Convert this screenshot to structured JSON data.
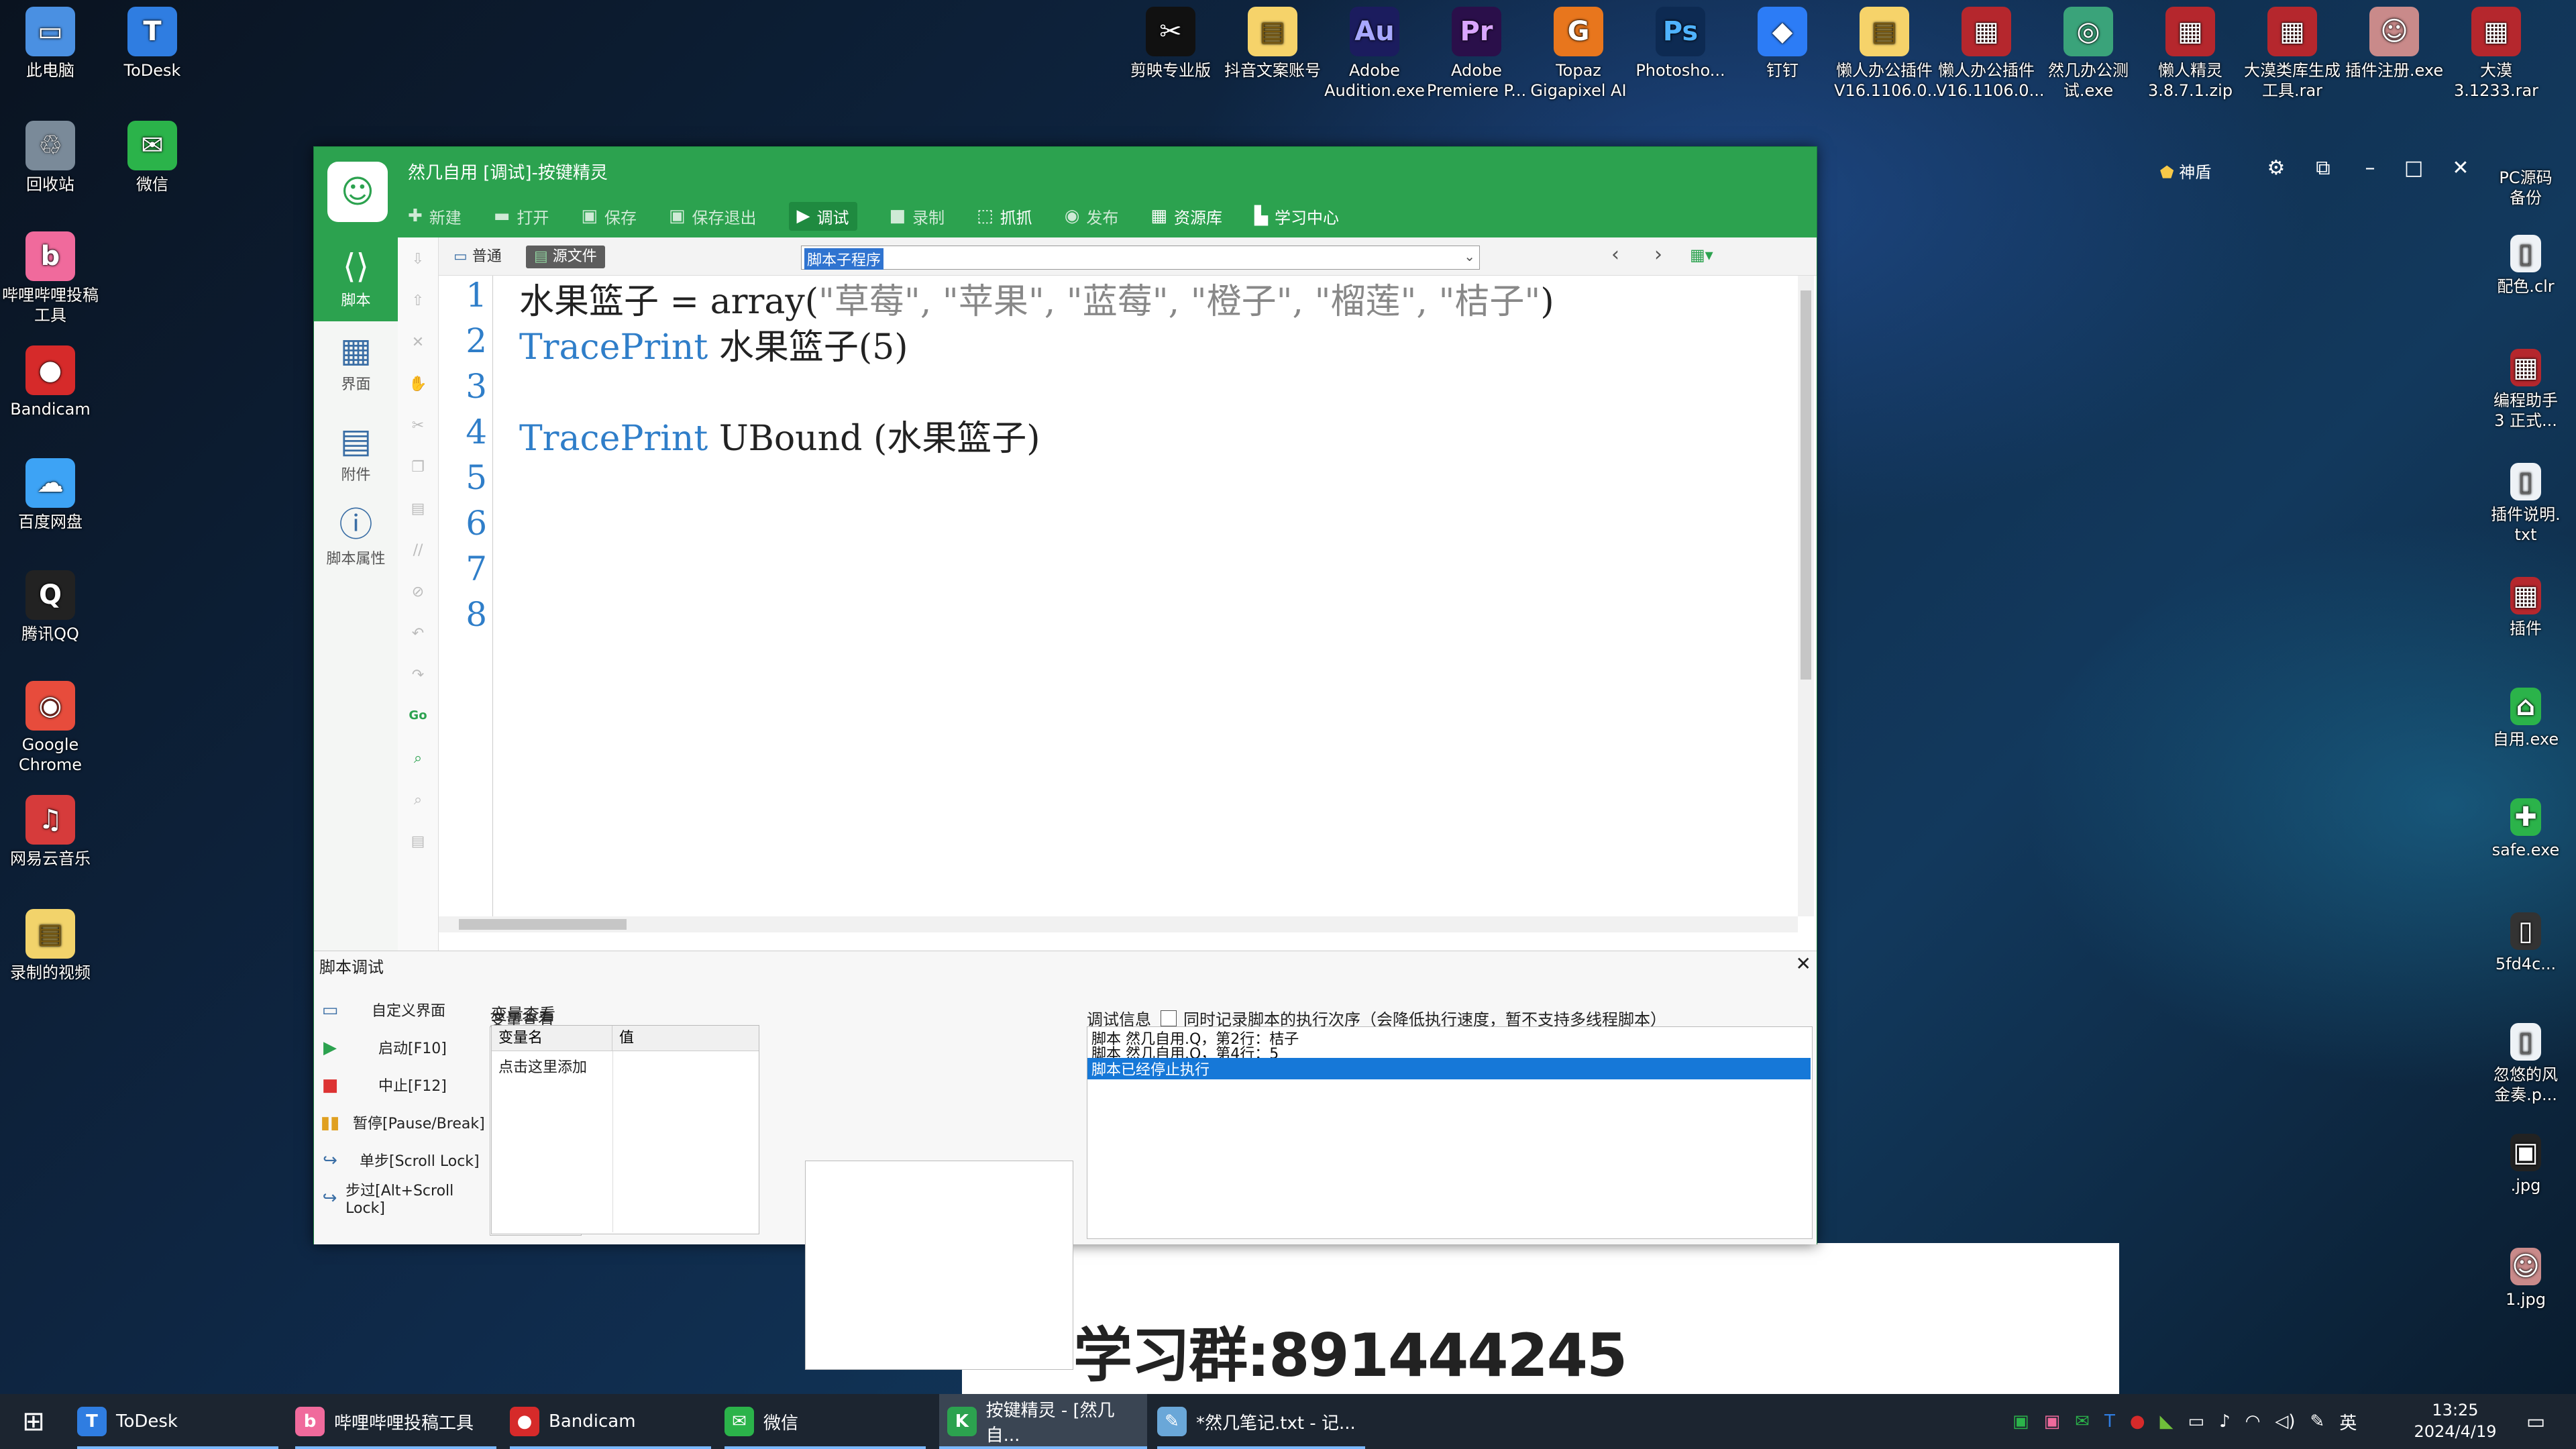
{
  "desktop": {
    "left_icons": [
      {
        "label": "此电脑",
        "color": "#4a90e2",
        "glyph": "▭"
      },
      {
        "label": "ToDesk",
        "color": "#2f7de1",
        "glyph": "T"
      },
      {
        "label": "回收站",
        "color": "#7a8a99",
        "glyph": "♲"
      },
      {
        "label": "微信",
        "color": "#2bb34a",
        "glyph": "✉"
      },
      {
        "label": "哔哩哔哩投稿\n工具",
        "color": "#f06a9c",
        "glyph": "b"
      },
      {
        "label": "Bandicam",
        "color": "#d62a2a",
        "glyph": "●"
      },
      {
        "label": "百度网盘",
        "color": "#3da3f5",
        "glyph": "☁"
      },
      {
        "label": "腾讯QQ",
        "color": "#222222",
        "glyph": "Q"
      },
      {
        "label": "Google\nChrome",
        "color": "#e74c3c",
        "glyph": "◉"
      },
      {
        "label": "网易云音乐",
        "color": "#d63b3b",
        "glyph": "♫"
      },
      {
        "label": "录制的视频",
        "color": "#f2d36b",
        "glyph": "▤"
      }
    ],
    "top_icons": [
      {
        "label": "剪映专业版",
        "color": "#111111",
        "glyph": "✂"
      },
      {
        "label": "抖音文案账号",
        "color": "#f6d36a",
        "glyph": "▤"
      },
      {
        "label": "Adobe\nAudition.exe",
        "color": "#1b1c5e",
        "glyph": "Au"
      },
      {
        "label": "Adobe\nPremiere P...",
        "color": "#2a0f4a",
        "glyph": "Pr"
      },
      {
        "label": "Topaz\nGigapixel AI",
        "color": "#e8761d",
        "glyph": "G"
      },
      {
        "label": "Photosho...",
        "color": "#0d2a52",
        "glyph": "Ps"
      },
      {
        "label": "钉钉",
        "color": "#2c7cf6",
        "glyph": "◆"
      },
      {
        "label": "懒人办公插件\nV16.1106.0...",
        "color": "#f6d36a",
        "glyph": "▤"
      },
      {
        "label": "懒人办公插件\nV16.1106.0...",
        "color": "#b5272d",
        "glyph": "▦"
      },
      {
        "label": "然几办公测\n试.exe",
        "color": "#3aa37a",
        "glyph": "◎"
      },
      {
        "label": "懒人精灵\n3.8.7.1.zip",
        "color": "#b5272d",
        "glyph": "▦"
      },
      {
        "label": "大漠类库生成\n工具.rar",
        "color": "#b5272d",
        "glyph": "▦"
      },
      {
        "label": "插件注册.exe",
        "color": "#c98a8a",
        "glyph": "☺"
      },
      {
        "label": "大漠\n3.1233.rar",
        "color": "#b5272d",
        "glyph": "▦"
      }
    ],
    "right_icons": [
      {
        "label": "PC源码\n备份"
      },
      {
        "label": "配色.clr"
      },
      {
        "label": "编程助手\n3 正式..."
      },
      {
        "label": "插件说明.\ntxt"
      },
      {
        "label": "插件"
      },
      {
        "label": "自用.exe"
      },
      {
        "label": "safe.exe"
      },
      {
        "label": "5fd4c..."
      },
      {
        "label": "忽悠的风\n金奏.p..."
      },
      {
        "label": ".jpg"
      },
      {
        "label": "1.jpg"
      }
    ]
  },
  "window": {
    "title": "然几自用 [调试]-按键精灵",
    "vip_label": "神盾",
    "toolbar": [
      {
        "label": "新建",
        "icon": "✚"
      },
      {
        "label": "打开",
        "icon": "▬"
      },
      {
        "label": "保存",
        "icon": "▣"
      },
      {
        "label": "保存退出",
        "icon": "▣"
      },
      {
        "label": "调试",
        "icon": "▶"
      },
      {
        "label": "录制",
        "icon": "■"
      },
      {
        "label": "抓抓",
        "icon": "⬚"
      },
      {
        "label": "发布",
        "icon": "◉"
      },
      {
        "label": "资源库",
        "icon": "▦"
      },
      {
        "label": "学习中心",
        "icon": "▙"
      }
    ],
    "nav": [
      {
        "label": "脚本",
        "icon": "⟨⟩"
      },
      {
        "label": "界面",
        "icon": "▦"
      },
      {
        "label": "附件",
        "icon": "▤"
      },
      {
        "label": "脚本属性",
        "icon": "ⓘ"
      }
    ],
    "editor_tabs": {
      "normal": "普通",
      "source": "源文件"
    },
    "procedure_select": "脚本子程序",
    "line_numbers": [
      "1",
      "2",
      "3",
      "4",
      "5",
      "6",
      "7",
      "8"
    ],
    "code": {
      "line1_var": "水果篮子 = array(",
      "line1_args": "\"草莓\", \"苹果\", \"蓝莓\", \"橙子\", \"榴莲\", \"桔子\"",
      "line1_end": ")",
      "line2_kw": "TracePrint",
      "line2_rest": " 水果篮子(5)",
      "line4_kw": "TracePrint",
      "line4_rest": " UBound (水果篮子)"
    },
    "debug": {
      "title": "脚本调试",
      "buttons": [
        {
          "label": "自定义界面",
          "icon": "▭",
          "color": "#3a6ea5"
        },
        {
          "label": "启动[F10]",
          "icon": "▶",
          "color": "#2ca24f"
        },
        {
          "label": "中止[F12]",
          "icon": "■",
          "color": "#d33"
        },
        {
          "label": "暂停[Pause/Break]",
          "icon": "▮▮",
          "color": "#e0a020"
        },
        {
          "label": "单步[Scroll Lock]",
          "icon": "↪",
          "color": "#3a6ea5"
        },
        {
          "label": "步过[Alt+Scroll Lock]",
          "icon": "↪",
          "color": "#3a6ea5"
        }
      ],
      "var_title": "变量查看",
      "var_col_name": "变量名",
      "var_col_value": "值",
      "var_add": "点击这里添加",
      "info_title": "调试信息",
      "info_checkbox": "同时记录脚本的执行次序（会降低执行速度，暂不支持多线程脚本）",
      "info_lines": [
        "脚本 然几自用.Q，第2行：桔子",
        "脚本 然几自用.Q，第4行：5",
        "脚本已经停止执行"
      ]
    }
  },
  "watermark": "学习群:891444245",
  "taskbar": {
    "items": [
      {
        "label": "ToDesk",
        "color": "#2f7de1",
        "glyph": "T"
      },
      {
        "label": "哔哩哔哩投稿工具",
        "color": "#f06a9c",
        "glyph": "b"
      },
      {
        "label": "Bandicam",
        "color": "#d62a2a",
        "glyph": "●"
      },
      {
        "label": "微信",
        "color": "#2bb34a",
        "glyph": "✉"
      },
      {
        "label": "按键精灵 - [然几自...",
        "color": "#2ca24f",
        "glyph": "K"
      },
      {
        "label": "*然几笔记.txt - 记...",
        "color": "#6aa7d8",
        "glyph": "✎"
      }
    ],
    "ime": "英",
    "time": "13:25",
    "date": "2024/4/19"
  }
}
